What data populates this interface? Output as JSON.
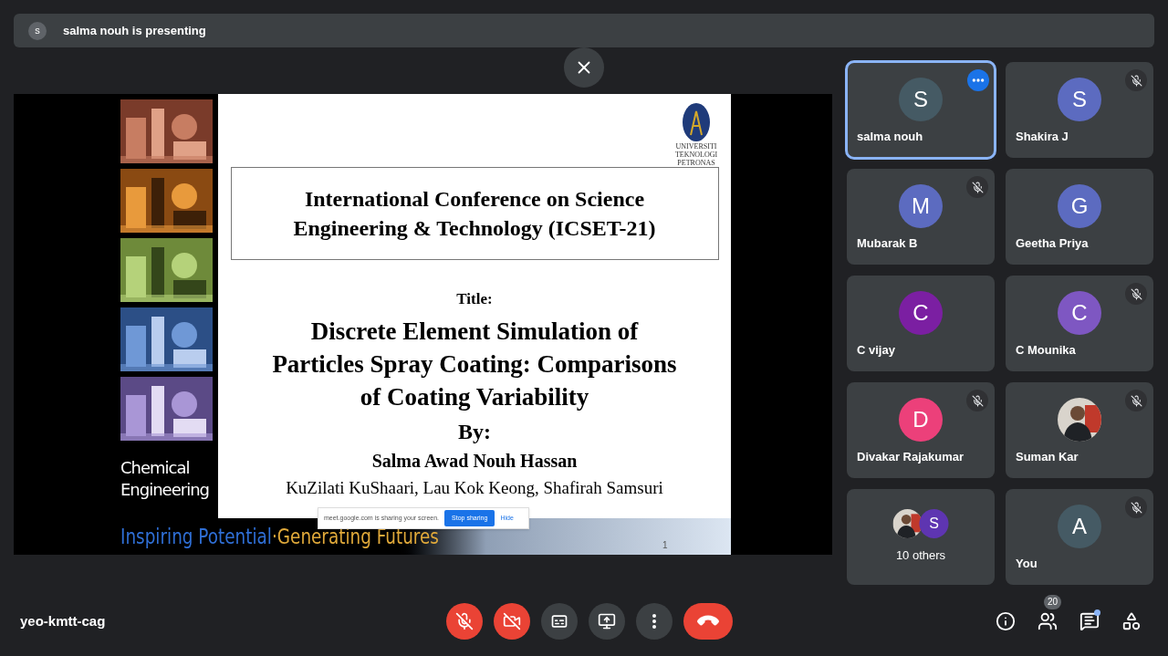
{
  "banner": {
    "avatar_letter": "s",
    "text": "salma nouh is presenting"
  },
  "slide": {
    "logo_text": "UNIVERSITI TEKNOLOGI PETRONAS",
    "heading_lines": [
      "International Conference on Science",
      "Engineering & Technology (ICSET-21)"
    ],
    "title_label": "Title:",
    "title_lines": [
      "Discrete Element Simulation of",
      "Particles Spray Coating: Comparisons",
      "of Coating Variability"
    ],
    "by_label": "By:",
    "author": "Salma Awad Nouh Hassan",
    "coauthors": "KuZilati KuShaari, Lau Kok Keong, Shafirah Samsuri",
    "side_caption": [
      "Chemical",
      "Engineering"
    ],
    "tagline": [
      {
        "text": "Inspiring Potential",
        "color": "#2f6fd6"
      },
      {
        "text": "·Generating Futures",
        "color": "#e0a93a"
      }
    ],
    "page_number": "1"
  },
  "share_bar": {
    "text": "meet.google.com is sharing your screen.",
    "stop": "Stop sharing",
    "hide": "Hide"
  },
  "tiles": [
    {
      "kind": "letter",
      "name": "salma nouh",
      "letter": "S",
      "color": "#455a64",
      "muted": false,
      "selected": true
    },
    {
      "kind": "letter",
      "name": "Shakira J",
      "letter": "S",
      "color": "#5c6bc0",
      "muted": true,
      "selected": false
    },
    {
      "kind": "letter",
      "name": "Mubarak B",
      "letter": "M",
      "color": "#5c6bc0",
      "muted": true,
      "selected": false
    },
    {
      "kind": "letter",
      "name": "Geetha Priya",
      "letter": "G",
      "color": "#5c6bc0",
      "muted": false,
      "selected": false
    },
    {
      "kind": "letter",
      "name": "C vijay",
      "letter": "C",
      "color": "#7b1fa2",
      "muted": false,
      "selected": false
    },
    {
      "kind": "letter",
      "name": "C Mounika",
      "letter": "C",
      "color": "#7e57c2",
      "muted": true,
      "selected": false
    },
    {
      "kind": "letter",
      "name": "Divakar Rajakumar",
      "letter": "D",
      "color": "#ec407a",
      "muted": true,
      "selected": false
    },
    {
      "name": "Suman Kar",
      "muted": true,
      "selected": false
    },
    {
      "kind": "group",
      "name": "10 others",
      "letter": "S",
      "color": "#5e35b1",
      "muted": false,
      "selected": false
    },
    {
      "kind": "letter",
      "name": "You",
      "letter": "A",
      "color": "#455a64",
      "muted": true,
      "selected": false
    }
  ],
  "meeting_code": "yeo-kmtt-cag",
  "controls": [
    {
      "kind": "mic",
      "off": true
    },
    {
      "kind": "camera",
      "off": true
    },
    {
      "kind": "captions",
      "off": false
    },
    {
      "kind": "present",
      "off": false
    },
    {
      "kind": "more",
      "off": false
    },
    {
      "kind": "hangup"
    }
  ],
  "side_buttons": [
    {
      "kind": "info"
    },
    {
      "kind": "people",
      "badge": "20"
    },
    {
      "kind": "chat",
      "unread": true
    },
    {
      "kind": "activities"
    }
  ]
}
